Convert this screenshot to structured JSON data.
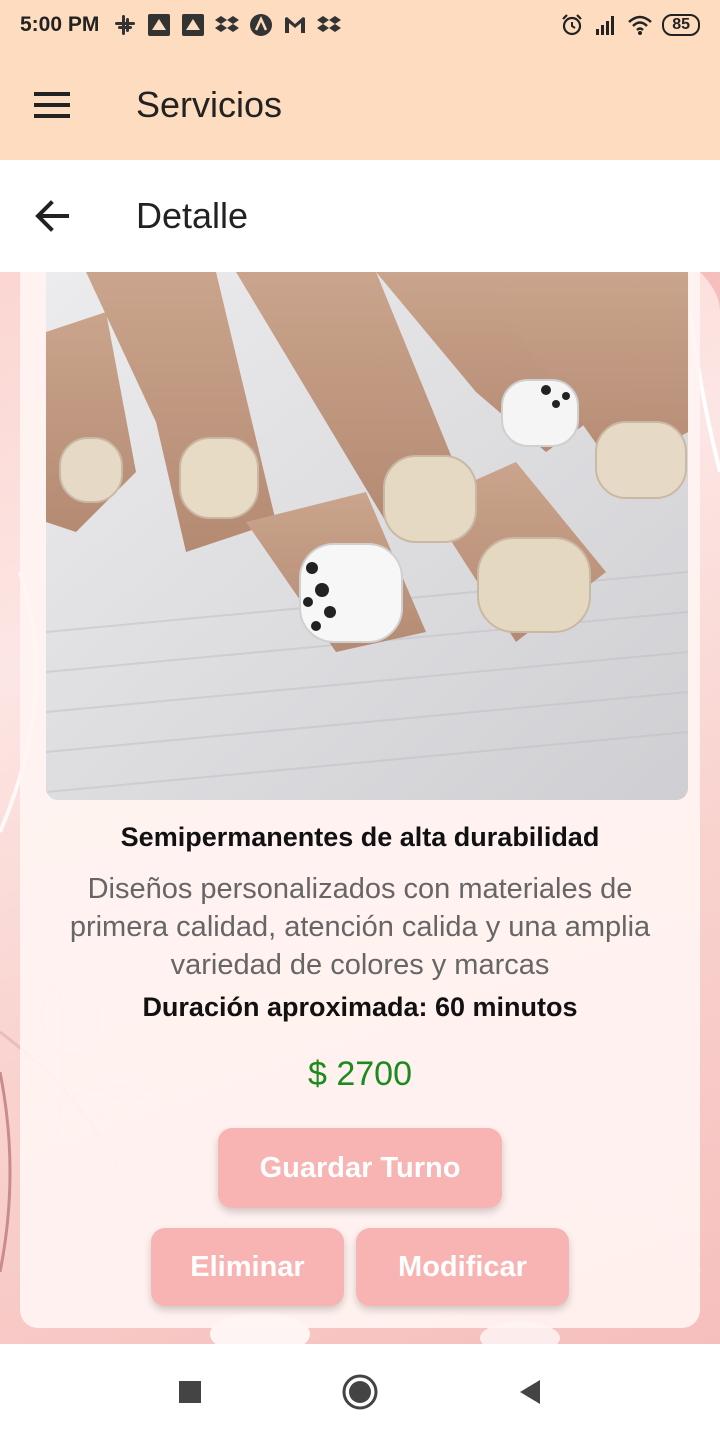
{
  "status_bar": {
    "time": "5:00 PM",
    "battery": "85",
    "left_icons": [
      "slack-icon",
      "app-icon",
      "app-icon",
      "dropbox-icon",
      "app-icon",
      "gmail-icon",
      "dropbox-icon"
    ],
    "right_icons": [
      "alarm-icon",
      "signal-icon",
      "wifi-icon",
      "battery-icon"
    ]
  },
  "app_bar": {
    "title": "Servicios",
    "menu_icon": "menu-icon"
  },
  "sub_bar": {
    "title": "Detalle",
    "back_icon": "arrow-left-icon"
  },
  "service": {
    "title": "Semipermanentes de alta durabilidad",
    "description": "Diseños personalizados con materiales de primera calidad, atención calida y una amplia variedad de colores y marcas",
    "duration": "Duración aproximada: 60 minutos",
    "price": "$ 2700"
  },
  "buttons": {
    "save": "Guardar Turno",
    "delete": "Eliminar",
    "edit": "Modificar"
  },
  "colors": {
    "app_bar_bg": "#fddcc0",
    "button_bg": "#f8b4b2",
    "price_color": "#1d8a1d"
  },
  "nav_bar": {
    "icons": [
      "recents-square-icon",
      "home-circle-icon",
      "back-triangle-icon"
    ]
  }
}
